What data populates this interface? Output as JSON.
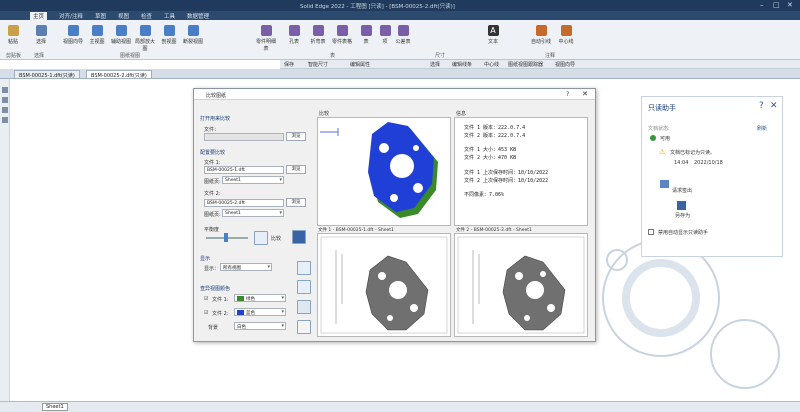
{
  "titlebar": {
    "title": "Solid Edge 2022 - 工程图 [只读] - [BSM-00025-2.dft(只读)]"
  },
  "ribbon": {
    "tabs": [
      "主页",
      "对齐/注释",
      "草图",
      "视图",
      "检查",
      "工具",
      "数据管理"
    ],
    "buttons": [
      "粘贴",
      "选择",
      "视图向导",
      "主视图",
      "辅助视图",
      "局部放大图",
      "剖视图",
      "断裂视图",
      "零件明细表",
      "孔表",
      "折弯表",
      "零件表格",
      "表",
      "项",
      "文本",
      "公差表",
      "自动引线",
      "中心线"
    ],
    "groups": [
      "剪贴板",
      "选择",
      "图纸视图",
      "尺寸",
      "表",
      "注释"
    ]
  },
  "toolbar2": {
    "items": [
      "保存",
      "智能尺寸",
      "编辑属性",
      "选择",
      "编辑线条",
      "中心线",
      "图纸视图跟踪器",
      "视图向导"
    ]
  },
  "doctabs": [
    "BSM-00025-1.dft(只读)",
    "BSM-00025-2.dft(只读)"
  ],
  "sheet_tab": "Sheet1",
  "dialog": {
    "title": "比较图纸",
    "sec_open": "打开用来比较",
    "file_label": "文件：",
    "browse": "浏览",
    "sec_config": "配置要比较",
    "file1_label": "文件 1:",
    "file1_value": "BSM-00025-1.dft",
    "sheet_label": "图纸页:",
    "sheet1_value": "Sheet1",
    "file2_label": "文件 2:",
    "file2_value": "BSM-00025-2.dft",
    "sheet2_value": "Sheet1",
    "overlap_label": "平衡度",
    "compare_btn": "比较",
    "display_label": "显示",
    "display_sel_label": "显示：",
    "display_sel_value": "所有视图",
    "colors_label": "查异视图颜色",
    "color1_label": "文件 1:",
    "color1_value": "绿色",
    "color2_label": "文件 2:",
    "color2_value": "蓝色",
    "bg_label": "背景",
    "bg_value": "白色",
    "compare_panel": "比较",
    "info_panel": "信息",
    "info_lines": [
      "文件 1 版本：222.0.7.4",
      "文件 2 版本：222.0.7.4",
      "文件 1 大小：453 KB",
      "文件 2 大小：470 KB",
      "文件 1 上次保存时间：10/10/2022",
      "文件 2 上次保存时间：10/10/2022",
      "不同像素：7.06%"
    ],
    "cap1": "文件 1 - BSM-00025-1.dft - Sheet1",
    "cap2": "文件 2 - BSM-00025-2.dft - Sheet1"
  },
  "readonly_assistant": {
    "title": "只读助手",
    "status_label": "文档状态:",
    "status_value": "可用",
    "refresh": "刷新",
    "msg": "文档已标记为只读。",
    "time": "14:04",
    "date": "2022/10/18",
    "checkout": "请求签出",
    "saveas": "另存为",
    "checkbox": "禁用自动显示只读助手"
  },
  "colors": {
    "file1": "#3a8a2a",
    "file2": "#1f3fd6",
    "accent": "#2b5797"
  }
}
